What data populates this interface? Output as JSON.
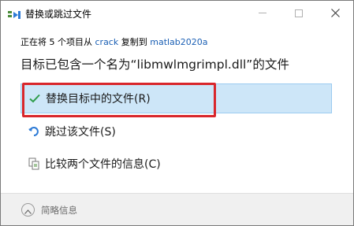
{
  "window": {
    "title": "替换或跳过文件",
    "icons": {
      "app": "move-files-icon",
      "minimize": "minimize-icon",
      "maximize": "maximize-icon",
      "close": "close-icon"
    }
  },
  "dialog": {
    "progress_prefix": "正在将 5 个项目从",
    "source_folder": "crack",
    "progress_middle": "复制到",
    "destination_folder": "matlab2020a",
    "heading": "目标已包含一个名为“libmwlmgrimpl.dll”的文件",
    "options": [
      {
        "label": "替换目标中的文件(R)",
        "icon": "checkmark-icon",
        "selected": true
      },
      {
        "label": "跳过该文件(S)",
        "icon": "skip-arrow-icon",
        "selected": false
      },
      {
        "label": "比较两个文件的信息(C)",
        "icon": "compare-files-icon",
        "selected": false
      }
    ]
  },
  "footer": {
    "toggle_label": "简略信息",
    "icon": "chevron-up-icon"
  },
  "colors": {
    "selected_bg": "#cde6f8",
    "highlight_border": "#d9262b",
    "check_green": "#2e9c4a",
    "link_blue": "#1a5fb4"
  }
}
